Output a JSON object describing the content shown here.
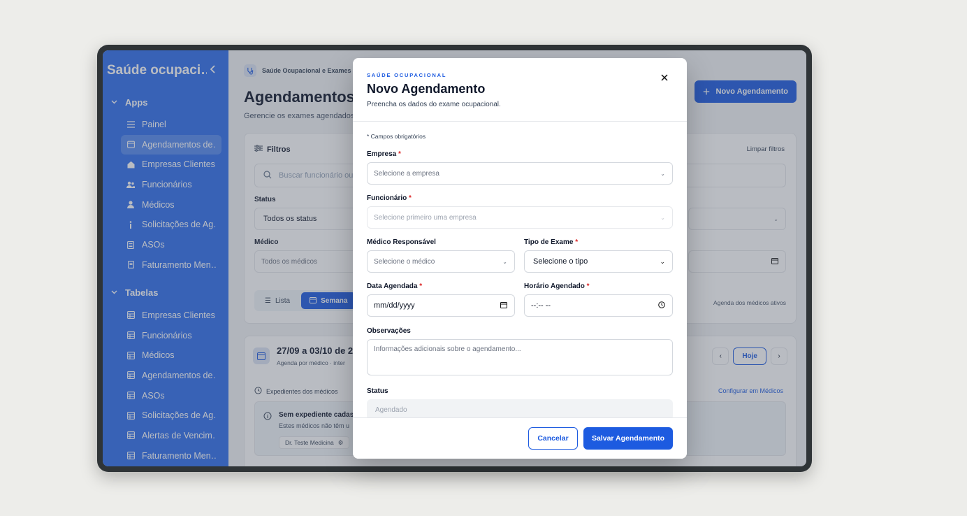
{
  "sidebar": {
    "title": "Saúde ocupaci…",
    "groups": [
      {
        "label": "Apps",
        "items": [
          {
            "label": "Painel",
            "icon": "list-icon"
          },
          {
            "label": "Agendamentos de…",
            "icon": "calendar-icon"
          },
          {
            "label": "Empresas Clientes",
            "icon": "home-icon"
          },
          {
            "label": "Funcionários",
            "icon": "users-icon"
          },
          {
            "label": "Médicos",
            "icon": "user-icon"
          },
          {
            "label": "Solicitações de Ag…",
            "icon": "info-icon"
          },
          {
            "label": "ASOs",
            "icon": "document-icon"
          },
          {
            "label": "Faturamento Men…",
            "icon": "receipt-icon"
          }
        ]
      },
      {
        "label": "Tabelas",
        "items": [
          {
            "label": "Empresas Clientes",
            "icon": "table-icon"
          },
          {
            "label": "Funcionários",
            "icon": "table-icon"
          },
          {
            "label": "Médicos",
            "icon": "table-icon"
          },
          {
            "label": "Agendamentos de…",
            "icon": "table-icon"
          },
          {
            "label": "ASOs",
            "icon": "table-icon"
          },
          {
            "label": "Solicitações de Ag…",
            "icon": "table-icon"
          },
          {
            "label": "Alertas de Vencim…",
            "icon": "table-icon"
          },
          {
            "label": "Faturamento Men…",
            "icon": "table-icon"
          }
        ]
      }
    ]
  },
  "main": {
    "breadcrumb": "Saúde Ocupacional e Exames",
    "title": "Agendamentos d",
    "subtitle": "Gerencie os exames agendados,",
    "new_button": "Novo Agendamento",
    "filters": {
      "title": "Filtros",
      "clear": "Limpar filtros",
      "search_placeholder": "Buscar funcionário ou",
      "status_label": "Status",
      "status_value": "Todos os status",
      "medico_label": "Médico",
      "medico_value": "Todos os médicos",
      "view_list": "Lista",
      "view_week": "Semana",
      "note": "Agenda dos médicos ativos"
    },
    "agenda": {
      "title": "27/09 a 03/10 de 20",
      "subtitle": "Agenda por médico · inter",
      "today": "Hoje",
      "expedientes": "Expedientes dos médicos",
      "configure": "Configurar em Médicos",
      "info_title": "Sem expediente cadast",
      "info_sub": "Estes médicos não têm u",
      "chip": "Dr. Teste Medicina"
    }
  },
  "modal": {
    "eyebrow": "SAÚDE OCUPACIONAL",
    "title": "Novo Agendamento",
    "subtitle": "Preencha os dados do exame ocupacional.",
    "required_note": "* Campos obrigatórios",
    "empresa_label": "Empresa",
    "empresa_placeholder": "Selecione a empresa",
    "funcionario_label": "Funcionário",
    "funcionario_placeholder": "Selecione primeiro uma empresa",
    "medico_label": "Médico Responsável",
    "medico_placeholder": "Selecione o médico",
    "tipo_label": "Tipo de Exame",
    "tipo_value": "Selecione o tipo",
    "data_label": "Data Agendada",
    "data_placeholder": "mm/dd/yyyy",
    "horario_label": "Horário Agendado",
    "horario_placeholder": "--:-- --",
    "obs_label": "Observações",
    "obs_placeholder": "Informações adicionais sobre o agendamento...",
    "status_label": "Status",
    "status_value": "Agendado",
    "required_mark": "*",
    "cancel": "Cancelar",
    "save": "Salvar Agendamento"
  },
  "colors": {
    "sidebar": "#2f6fec",
    "primary": "#1d5be0",
    "required": "#dc2626"
  }
}
